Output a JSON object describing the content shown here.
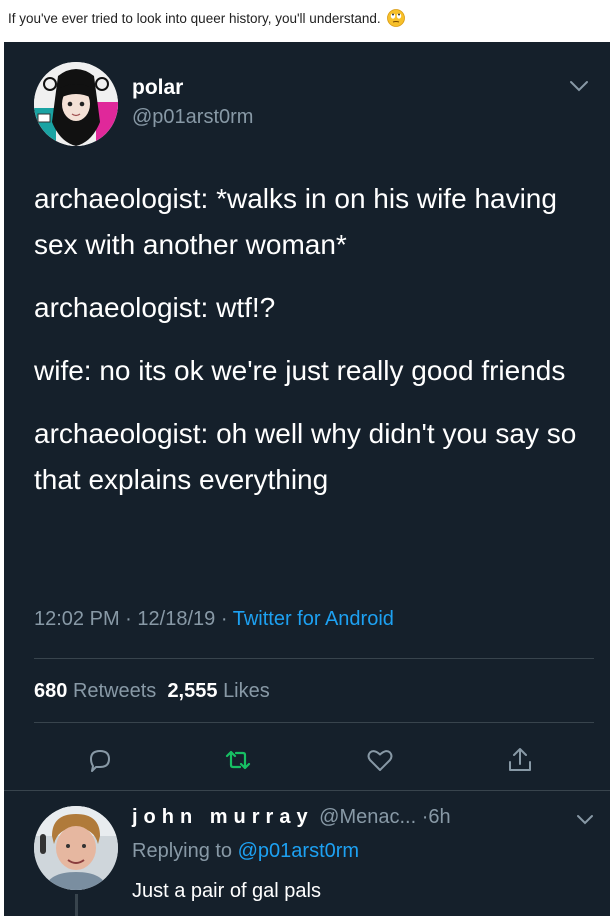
{
  "post": {
    "caption": "If you've ever tried to look into queer history, you'll understand.",
    "caption_emoji": "rolling-eyes-emoji"
  },
  "tweet": {
    "author": {
      "name": "polar",
      "handle": "@p01arst0rm",
      "avatar": "anime-avatar"
    },
    "lines": [
      "archaeologist: *walks in on his wife having sex with another woman*",
      "archaeologist: wtf!?",
      "wife: no its ok we're just really good friends",
      "archaeologist: oh well why didn't you say so that explains everything"
    ],
    "time": "12:02 PM",
    "date": "12/18/19",
    "separator": "·",
    "source": "Twitter for Android",
    "retweets_count": "680",
    "retweets_label": "Retweets",
    "likes_count": "2,555",
    "likes_label": "Likes",
    "actions": [
      "reply-icon",
      "retweet-icon",
      "like-icon",
      "share-icon"
    ]
  },
  "reply": {
    "name": "john murray",
    "handle": "@Menac...",
    "time": "·6h",
    "replying_prefix": "Replying to",
    "replying_to": "@p01arst0rm",
    "text": "Just a pair of gal pals"
  },
  "colors": {
    "background": "#15202b",
    "text": "#ffffff",
    "secondary": "#8899a6",
    "accent": "#1da1f2",
    "retweet": "#17bf63",
    "divider": "#38444d"
  }
}
